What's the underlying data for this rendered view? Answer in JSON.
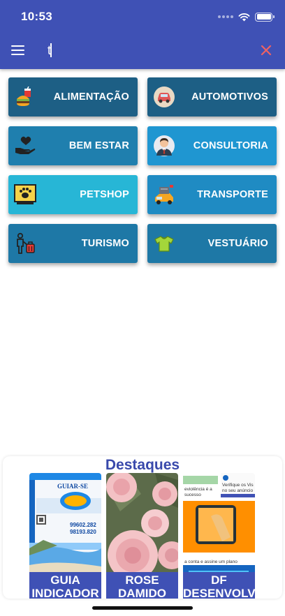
{
  "status_bar": {
    "time": "10:53"
  },
  "search": {
    "value": "t"
  },
  "categories": [
    {
      "label": "ALIMENTAÇÃO",
      "icon": "fast-food-icon",
      "color": "#1d5f85"
    },
    {
      "label": "AUTOMOTIVOS",
      "icon": "car-icon",
      "color": "#1d5f85"
    },
    {
      "label": "BEM ESTAR",
      "icon": "heart-hand-icon",
      "color": "#1f7fae"
    },
    {
      "label": "CONSULTORIA",
      "icon": "consultant-icon",
      "color": "#1f96d1"
    },
    {
      "label": "PETSHOP",
      "icon": "paw-icon",
      "color": "#27b6d6"
    },
    {
      "label": "TRANSPORTE",
      "icon": "truck-icon",
      "color": "#1f8bc3"
    },
    {
      "label": "TURISMO",
      "icon": "traveler-icon",
      "color": "#1e78a6"
    },
    {
      "label": "VESTUÁRIO",
      "icon": "tshirt-icon",
      "color": "#1e78a6"
    }
  ],
  "destaques": {
    "title": "Destaques",
    "cards": [
      {
        "caption": "GUIA INDICADOR",
        "image": "guia-se-flyer-image",
        "flyer_title": "GUIAR-SE",
        "flyer_phone1": "99602.282",
        "flyer_phone2": "98193.820"
      },
      {
        "caption": "ROSE DAMIDO",
        "image": "pink-roses-image"
      },
      {
        "caption": "DF DESENVOLVI",
        "image": "app-promo-image",
        "promo_text1": "Verifique os Vis",
        "promo_text2": "no seu anúncio",
        "promo_text3": "eviolência é a",
        "promo_text4": "sucesso",
        "promo_text5": "a conta e assine um plano"
      }
    ]
  },
  "colors": {
    "header": "#3f51b5",
    "close_icon": "#f06262",
    "destaques_title": "#3949ab"
  }
}
